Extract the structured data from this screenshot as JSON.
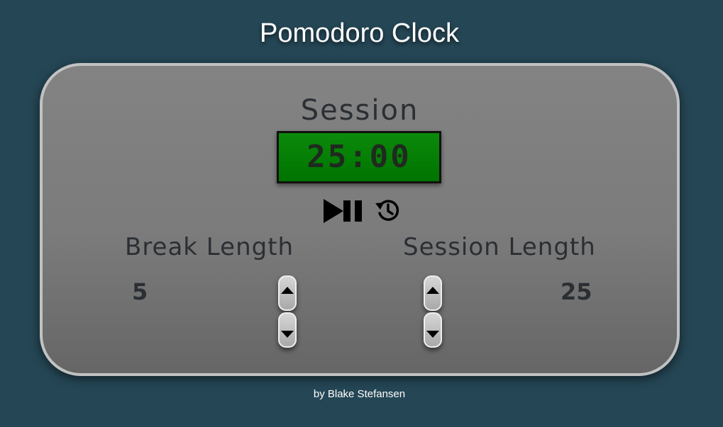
{
  "header": {
    "title": "Pomodoro Clock"
  },
  "timer": {
    "mode_label": "Session",
    "display": "25:00",
    "display_color": "#007f00"
  },
  "controls": {
    "play_pause_icon": "play-pause-icon",
    "reset_icon": "history-reset-icon"
  },
  "break_setting": {
    "label": "Break Length",
    "value": "5",
    "up_icon": "triangle-up-icon",
    "down_icon": "triangle-down-icon"
  },
  "session_setting": {
    "label": "Session Length",
    "value": "25",
    "up_icon": "triangle-up-icon",
    "down_icon": "triangle-down-icon"
  },
  "footer": {
    "credit": "by Blake Stefansen"
  },
  "colors": {
    "background": "#254655",
    "panel": "#7b7b7b",
    "panel_border": "#c2c2c2",
    "text_dark": "#2b2f34"
  }
}
